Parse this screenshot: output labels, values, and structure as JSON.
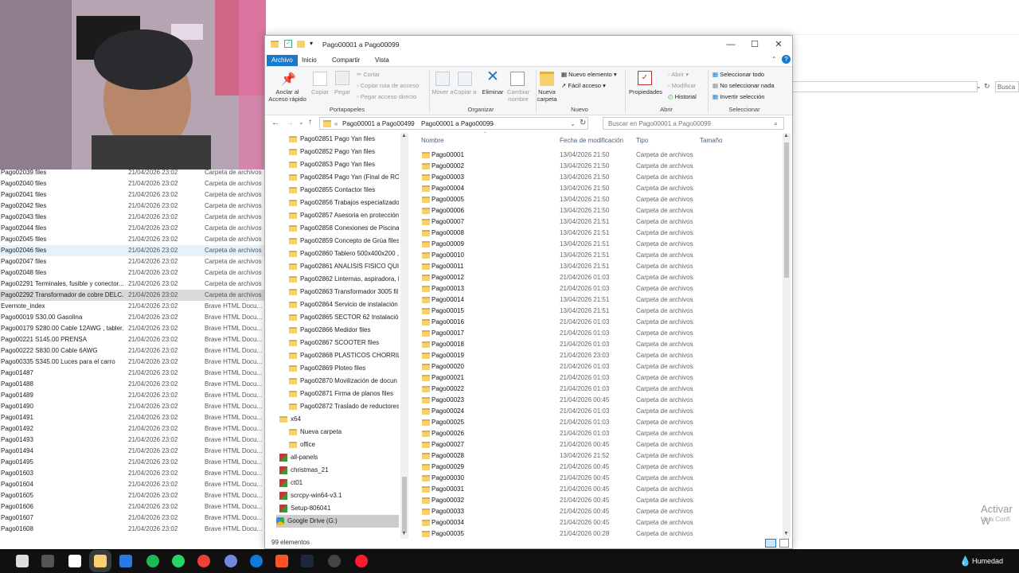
{
  "explorer": {
    "title": "Pago00001 a Pago00099",
    "tabs": [
      "Archivo",
      "Inicio",
      "Compartir",
      "Vista"
    ],
    "ribbon": {
      "pin_label_1": "Anclar al",
      "pin_label_2": "Acceso rápido",
      "copy": "Copiar",
      "paste": "Pegar",
      "cut": "Cortar",
      "copy_path": "Copiar ruta de acceso",
      "paste_shortcut": "Pegar acceso directo",
      "group_clipboard": "Portapapeles",
      "move_to": "Mover a",
      "copy_to": "Copiar a",
      "delete": "Eliminar",
      "rename_1": "Cambiar",
      "rename_2": "nombre",
      "group_organize": "Organizar",
      "new_folder_1": "Nueva",
      "new_folder_2": "carpeta",
      "new_item": "Nuevo elemento",
      "easy_access": "Fácil acceso",
      "group_new": "Nuevo",
      "properties": "Propiedades",
      "open": "Abrir",
      "edit": "Modificar",
      "history": "Historial",
      "group_open": "Abrir",
      "select_all": "Seleccionar todo",
      "select_none": "No seleccionar nada",
      "invert_selection": "Invertir selección",
      "group_select": "Seleccionar"
    },
    "address": {
      "prefix": "«",
      "crumb1": "Pago00001 a Pago00499",
      "crumb2": "Pago00001 a Pago00099"
    },
    "search_placeholder": "Buscar en Pago00001 a Pago00099",
    "nav_items": [
      {
        "label": "Pago02851 Pago Yan files",
        "kind": "folder",
        "indent": 2
      },
      {
        "label": "Pago02852 Pago Yan files",
        "kind": "folder",
        "indent": 2
      },
      {
        "label": "Pago02853 Pago Yan files",
        "kind": "folder",
        "indent": 2
      },
      {
        "label": "Pago02854 Pago Yan (Final de ROI",
        "kind": "folder",
        "indent": 2
      },
      {
        "label": "Pago02855 Contactor files",
        "kind": "folder",
        "indent": 2
      },
      {
        "label": "Pago02856 Trabajos especializados",
        "kind": "folder",
        "indent": 2
      },
      {
        "label": "Pago02857 Asesoria en protección",
        "kind": "folder",
        "indent": 2
      },
      {
        "label": "Pago02858 Conexiones de Piscina",
        "kind": "folder",
        "indent": 2
      },
      {
        "label": "Pago02859 Concepto de Grúa files",
        "kind": "folder",
        "indent": 2
      },
      {
        "label": "Pago02860 Tablero 500x400x200 , I",
        "kind": "folder",
        "indent": 2
      },
      {
        "label": "Pago02861 ANALISIS FISICO QUIM",
        "kind": "folder",
        "indent": 2
      },
      {
        "label": "Pago02862 Linternas, aspiradora, H",
        "kind": "folder",
        "indent": 2
      },
      {
        "label": "Pago02863 Transformador 3005 fil",
        "kind": "folder",
        "indent": 2
      },
      {
        "label": "Pago02864 Servicio de instalación",
        "kind": "folder",
        "indent": 2
      },
      {
        "label": "Pago02865 SECTOR 62 Instalación",
        "kind": "folder",
        "indent": 2
      },
      {
        "label": "Pago02866 Medidor files",
        "kind": "folder",
        "indent": 2
      },
      {
        "label": "Pago02867 SCOOTER files",
        "kind": "folder",
        "indent": 2
      },
      {
        "label": "Pago02868 PLASTICOS CHORRILL",
        "kind": "folder",
        "indent": 2
      },
      {
        "label": "Pago02869 Ploteo files",
        "kind": "folder",
        "indent": 2
      },
      {
        "label": "Pago02870 Movilización de docun",
        "kind": "folder",
        "indent": 2
      },
      {
        "label": "Pago02871 Firma de planos files",
        "kind": "folder",
        "indent": 2
      },
      {
        "label": "Pago02872 Traslado de reductores",
        "kind": "folder",
        "indent": 2
      },
      {
        "label": "x64",
        "kind": "folder",
        "indent": 1
      },
      {
        "label": "Nueva carpeta",
        "kind": "folder",
        "indent": 2
      },
      {
        "label": "office",
        "kind": "folder",
        "indent": 2
      },
      {
        "label": "all-panels",
        "kind": "app",
        "indent": 1
      },
      {
        "label": "christmas_21",
        "kind": "app",
        "indent": 1
      },
      {
        "label": "ct01",
        "kind": "app",
        "indent": 1
      },
      {
        "label": "scrcpy-win64-v3.1",
        "kind": "app",
        "indent": 1
      },
      {
        "label": "Setup-806041",
        "kind": "app",
        "indent": 1
      },
      {
        "label": "Google Drive (G:)",
        "kind": "drive",
        "indent": 0
      }
    ],
    "columns": {
      "name": "Nombre",
      "date": "Fecha de modificación",
      "type": "Tipo",
      "size": "Tamaño"
    },
    "files": [
      {
        "name": "Pago00001",
        "date": "13/04/2026 21:50",
        "type": "Carpeta de archivos"
      },
      {
        "name": "Pago00002",
        "date": "13/04/2026 21:50",
        "type": "Carpeta de archivos"
      },
      {
        "name": "Pago00003",
        "date": "13/04/2026 21:50",
        "type": "Carpeta de archivos"
      },
      {
        "name": "Pago00004",
        "date": "13/04/2026 21:50",
        "type": "Carpeta de archivos"
      },
      {
        "name": "Pago00005",
        "date": "13/04/2026 21:50",
        "type": "Carpeta de archivos"
      },
      {
        "name": "Pago00006",
        "date": "13/04/2026 21:50",
        "type": "Carpeta de archivos"
      },
      {
        "name": "Pago00007",
        "date": "13/04/2026 21:51",
        "type": "Carpeta de archivos"
      },
      {
        "name": "Pago00008",
        "date": "13/04/2026 21:51",
        "type": "Carpeta de archivos"
      },
      {
        "name": "Pago00009",
        "date": "13/04/2026 21:51",
        "type": "Carpeta de archivos"
      },
      {
        "name": "Pago00010",
        "date": "13/04/2026 21:51",
        "type": "Carpeta de archivos"
      },
      {
        "name": "Pago00011",
        "date": "13/04/2026 21:51",
        "type": "Carpeta de archivos"
      },
      {
        "name": "Pago00012",
        "date": "21/04/2026 01:03",
        "type": "Carpeta de archivos"
      },
      {
        "name": "Pago00013",
        "date": "21/04/2026 01:03",
        "type": "Carpeta de archivos"
      },
      {
        "name": "Pago00014",
        "date": "13/04/2026 21:51",
        "type": "Carpeta de archivos"
      },
      {
        "name": "Pago00015",
        "date": "13/04/2026 21:51",
        "type": "Carpeta de archivos"
      },
      {
        "name": "Pago00016",
        "date": "21/04/2026 01:03",
        "type": "Carpeta de archivos"
      },
      {
        "name": "Pago00017",
        "date": "21/04/2026 01:03",
        "type": "Carpeta de archivos"
      },
      {
        "name": "Pago00018",
        "date": "21/04/2026 01:03",
        "type": "Carpeta de archivos"
      },
      {
        "name": "Pago00019",
        "date": "21/04/2026 23:03",
        "type": "Carpeta de archivos"
      },
      {
        "name": "Pago00020",
        "date": "21/04/2026 01:03",
        "type": "Carpeta de archivos"
      },
      {
        "name": "Pago00021",
        "date": "21/04/2026 01:03",
        "type": "Carpeta de archivos"
      },
      {
        "name": "Pago00022",
        "date": "21/04/2026 01:03",
        "type": "Carpeta de archivos"
      },
      {
        "name": "Pago00023",
        "date": "21/04/2026 00:45",
        "type": "Carpeta de archivos"
      },
      {
        "name": "Pago00024",
        "date": "21/04/2026 01:03",
        "type": "Carpeta de archivos"
      },
      {
        "name": "Pago00025",
        "date": "21/04/2026 01:03",
        "type": "Carpeta de archivos"
      },
      {
        "name": "Pago00026",
        "date": "21/04/2026 01:03",
        "type": "Carpeta de archivos"
      },
      {
        "name": "Pago00027",
        "date": "21/04/2026 00:45",
        "type": "Carpeta de archivos"
      },
      {
        "name": "Pago00028",
        "date": "13/04/2026 21:52",
        "type": "Carpeta de archivos"
      },
      {
        "name": "Pago00029",
        "date": "21/04/2026 00:45",
        "type": "Carpeta de archivos"
      },
      {
        "name": "Pago00030",
        "date": "21/04/2026 00:45",
        "type": "Carpeta de archivos"
      },
      {
        "name": "Pago00031",
        "date": "21/04/2026 00:45",
        "type": "Carpeta de archivos"
      },
      {
        "name": "Pago00032",
        "date": "21/04/2026 00:45",
        "type": "Carpeta de archivos"
      },
      {
        "name": "Pago00033",
        "date": "21/04/2026 00:45",
        "type": "Carpeta de archivos"
      },
      {
        "name": "Pago00034",
        "date": "21/04/2026 00:45",
        "type": "Carpeta de archivos"
      },
      {
        "name": "Pago00035",
        "date": "21/04/2026 00:28",
        "type": "Carpeta de archivos"
      }
    ],
    "status": "99 elementos"
  },
  "background_list": [
    {
      "name": "Pago02039 files",
      "date": "21/04/2026 23:02",
      "type": "Carpeta de archivos"
    },
    {
      "name": "Pago02040 files",
      "date": "21/04/2026 23:02",
      "type": "Carpeta de archivos"
    },
    {
      "name": "Pago02041 files",
      "date": "21/04/2026 23:02",
      "type": "Carpeta de archivos"
    },
    {
      "name": "Pago02042 files",
      "date": "21/04/2026 23:02",
      "type": "Carpeta de archivos"
    },
    {
      "name": "Pago02043 files",
      "date": "21/04/2026 23:02",
      "type": "Carpeta de archivos"
    },
    {
      "name": "Pago02044 files",
      "date": "21/04/2026 23:02",
      "type": "Carpeta de archivos"
    },
    {
      "name": "Pago02045 files",
      "date": "21/04/2026 23:02",
      "type": "Carpeta de archivos"
    },
    {
      "name": "Pago02046 files",
      "date": "21/04/2026 23:02",
      "type": "Carpeta de archivos",
      "state": "hover"
    },
    {
      "name": "Pago02047 files",
      "date": "21/04/2026 23:02",
      "type": "Carpeta de archivos"
    },
    {
      "name": "Pago02048 files",
      "date": "21/04/2026 23:02",
      "type": "Carpeta de archivos"
    },
    {
      "name": "Pago02291 Terminales, fusible y conector...",
      "date": "21/04/2026 23:02",
      "type": "Carpeta de archivos"
    },
    {
      "name": "Pago02292 Transformador de cobre DELC...",
      "date": "21/04/2026 23:02",
      "type": "Carpeta de archivos",
      "state": "selected"
    },
    {
      "name": "Evernote_index",
      "date": "21/04/2026 23:02",
      "type": "Brave HTML Docu..."
    },
    {
      "name": "Pago00019 S30.00 Gasolina",
      "date": "21/04/2026 23:02",
      "type": "Brave HTML Docu..."
    },
    {
      "name": "Pago00179 S280.00 Cable 12AWG , tabler...",
      "date": "21/04/2026 23:02",
      "type": "Brave HTML Docu..."
    },
    {
      "name": "Pago00221 S145.00 PRENSA",
      "date": "21/04/2026 23:02",
      "type": "Brave HTML Docu..."
    },
    {
      "name": "Pago00222 S830.00 Cable 6AWG",
      "date": "21/04/2026 23:02",
      "type": "Brave HTML Docu..."
    },
    {
      "name": "Pago00335 S345.00 Luces para el carro",
      "date": "21/04/2026 23:02",
      "type": "Brave HTML Docu..."
    },
    {
      "name": "Pago01487",
      "date": "21/04/2026 23:02",
      "type": "Brave HTML Docu..."
    },
    {
      "name": "Pago01488",
      "date": "21/04/2026 23:02",
      "type": "Brave HTML Docu..."
    },
    {
      "name": "Pago01489",
      "date": "21/04/2026 23:02",
      "type": "Brave HTML Docu..."
    },
    {
      "name": "Pago01490",
      "date": "21/04/2026 23:02",
      "type": "Brave HTML Docu..."
    },
    {
      "name": "Pago01491",
      "date": "21/04/2026 23:02",
      "type": "Brave HTML Docu..."
    },
    {
      "name": "Pago01492",
      "date": "21/04/2026 23:02",
      "type": "Brave HTML Docu..."
    },
    {
      "name": "Pago01493",
      "date": "21/04/2026 23:02",
      "type": "Brave HTML Docu..."
    },
    {
      "name": "Pago01494",
      "date": "21/04/2026 23:02",
      "type": "Brave HTML Docu..."
    },
    {
      "name": "Pago01495",
      "date": "21/04/2026 23:02",
      "type": "Brave HTML Docu..."
    },
    {
      "name": "Pago01603",
      "date": "21/04/2026 23:02",
      "type": "Brave HTML Docu..."
    },
    {
      "name": "Pago01604",
      "date": "21/04/2026 23:02",
      "type": "Brave HTML Docu..."
    },
    {
      "name": "Pago01605",
      "date": "21/04/2026 23:02",
      "type": "Brave HTML Docu..."
    },
    {
      "name": "Pago01606",
      "date": "21/04/2026 23:02",
      "type": "Brave HTML Docu..."
    },
    {
      "name": "Pago01607",
      "date": "21/04/2026 23:02",
      "type": "Brave HTML Docu..."
    },
    {
      "name": "Pago01608",
      "date": "21/04/2026 23:02",
      "type": "Brave HTML Docu..."
    }
  ],
  "background_window": {
    "search_label": "Busca",
    "watermark_title": "Activar W",
    "watermark_sub": "Ve a Confi"
  },
  "taskbar": {
    "weather": "Humedad",
    "icons": [
      "task-view-icon",
      "file-manager-icon",
      "store-icon",
      "file-explorer-icon",
      "mail-icon",
      "spotify-icon",
      "whatsapp-icon",
      "chrome-icon",
      "discord-icon",
      "edge-icon",
      "brave-icon",
      "steam-icon",
      "obs-icon",
      "opera-icon"
    ]
  },
  "colors": {
    "accent": "#1979ca",
    "selection": "#cce8ff",
    "taskbar": "#101010"
  }
}
